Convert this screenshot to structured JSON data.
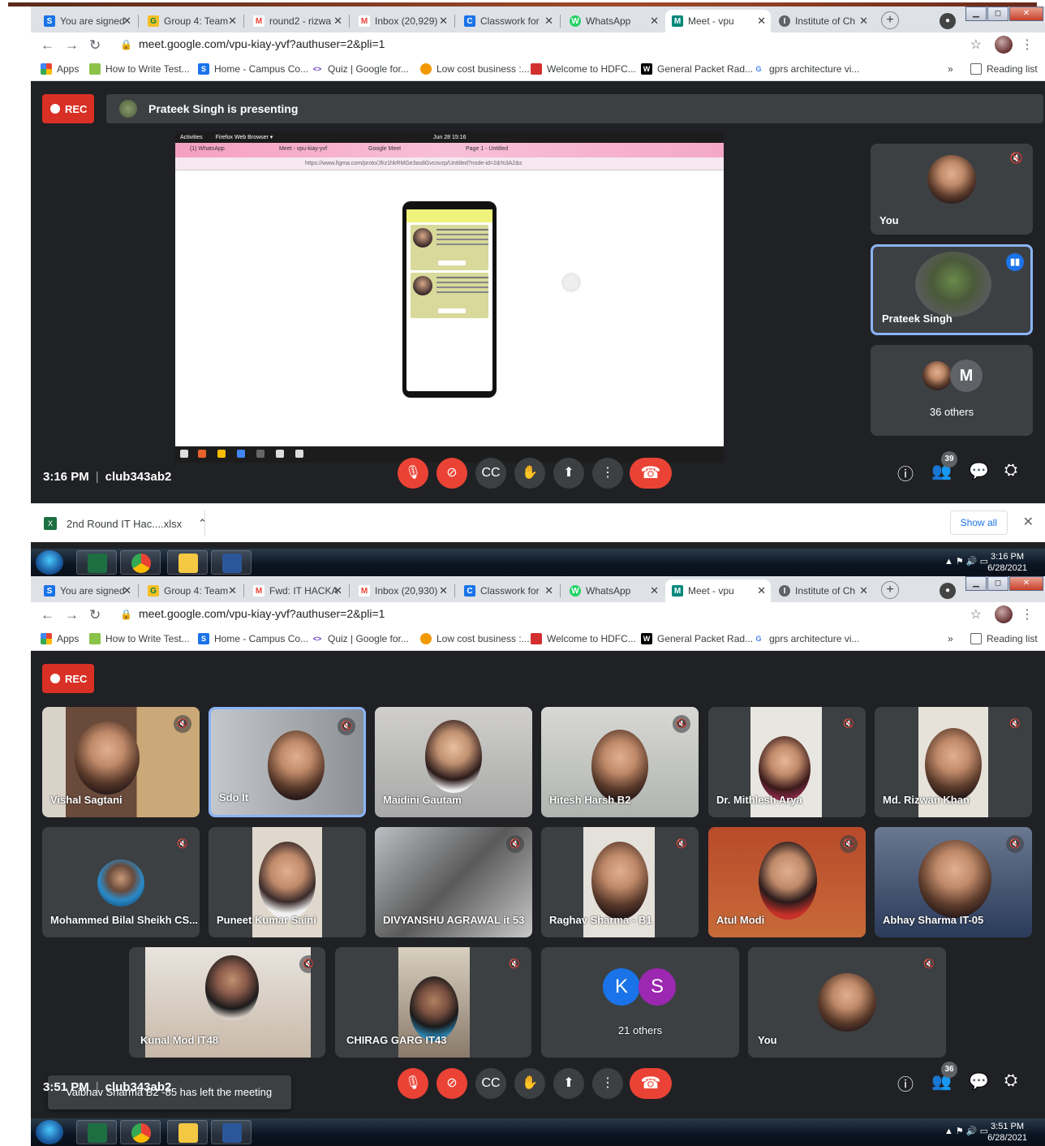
{
  "shot1": {
    "tabs": [
      {
        "label": "You are signed",
        "icon": "S",
        "color": "#1a73e8"
      },
      {
        "label": "Group 4: Team",
        "icon": "G",
        "color": "#0b8043"
      },
      {
        "label": "round2 - rizwa",
        "icon": "M",
        "color": "#ea4335"
      },
      {
        "label": "Inbox (20,929)",
        "icon": "M",
        "color": "#ea4335"
      },
      {
        "label": "Classwork for",
        "icon": "C",
        "color": "#1a73e8"
      },
      {
        "label": "WhatsApp",
        "icon": "W",
        "color": "#25d366"
      },
      {
        "label": "Meet - vpu",
        "icon": "M",
        "color": "#00897b"
      },
      {
        "label": "Institute of Ch",
        "icon": "I",
        "color": "#5f6368"
      }
    ],
    "url": "meet.google.com/vpu-kiay-yvf?authuser=2&pli=1",
    "presenting_text": "Prateek Singh is presenting",
    "rec_label": "REC",
    "firefox": {
      "activities": "Activities",
      "browser": "Firefox Web Browser ▾",
      "date": "Jun 28 15:16",
      "tab_whatsapp": "(1) WhatsApp",
      "tab_meet": "Meet - vpu-kiay-yvf",
      "tab_gmeet": "Google Meet",
      "tab_figma": "Page 1 - Untitled",
      "url": "https://www.figma.com/proto/Jfrz1hkRMGe3as8Gvcovzp/Untitled?node-id=2&%3A2&s"
    },
    "side": {
      "you": "You",
      "prateek": "Prateek Singh",
      "others": "36 others",
      "others_avatar": "M"
    },
    "time": "3:16 PM",
    "meeting_code": "club343ab2",
    "participants_count": "39",
    "download_file": "2nd Round IT Hac....xlsx",
    "show_all": "Show all",
    "tray_time": "3:16 PM",
    "tray_date": "6/28/2021"
  },
  "shot2": {
    "tabs": [
      {
        "label": "You are signed",
        "icon": "S",
        "color": "#1a73e8"
      },
      {
        "label": "Group 4: Team",
        "icon": "G",
        "color": "#0b8043"
      },
      {
        "label": "Fwd: IT HACKA",
        "icon": "M",
        "color": "#ea4335"
      },
      {
        "label": "Inbox (20,930)",
        "icon": "M",
        "color": "#ea4335"
      },
      {
        "label": "Classwork for",
        "icon": "C",
        "color": "#1a73e8"
      },
      {
        "label": "WhatsApp",
        "icon": "W",
        "color": "#25d366"
      },
      {
        "label": "Meet - vpu",
        "icon": "M",
        "color": "#00897b"
      },
      {
        "label": "Institute of Ch",
        "icon": "I",
        "color": "#5f6368"
      }
    ],
    "url": "meet.google.com/vpu-kiay-yvf?authuser=2&pli=1",
    "rec_label": "REC",
    "participants": [
      "Vishal Sagtani",
      "Sdo It",
      "Maidini Gautam",
      "Hitesh Harsh B2",
      "Dr. Mithlesh Arya",
      "Md. Rizwan Khan",
      "Mohammed Bilal Sheikh CS...",
      "Puneet Kumar Saini",
      "DIVYANSHU AGRAWAL it 53",
      "Raghav Sharma - B1",
      "Atul Modi",
      "Abhay Sharma IT-05",
      "Kunal Mod IT48",
      "CHIRAG GARG IT43"
    ],
    "others": "21 others",
    "others_k": "K",
    "others_s": "S",
    "you": "You",
    "toast": "Vaibhav Sharma B2 -85 has left the meeting",
    "time": "3:51 PM",
    "meeting_code": "club343ab2",
    "participants_count": "36",
    "tray_time": "3:51 PM",
    "tray_date": "6/28/2021"
  },
  "bookmarks": [
    "Apps",
    "How to Write Test...",
    "Home - Campus Co...",
    "Quiz | Google for...",
    "Low cost business :...",
    "Welcome to HDFC...",
    "General Packet Rad...",
    "gprs architecture vi..."
  ],
  "reading_list": "Reading list",
  "overflow": "»"
}
